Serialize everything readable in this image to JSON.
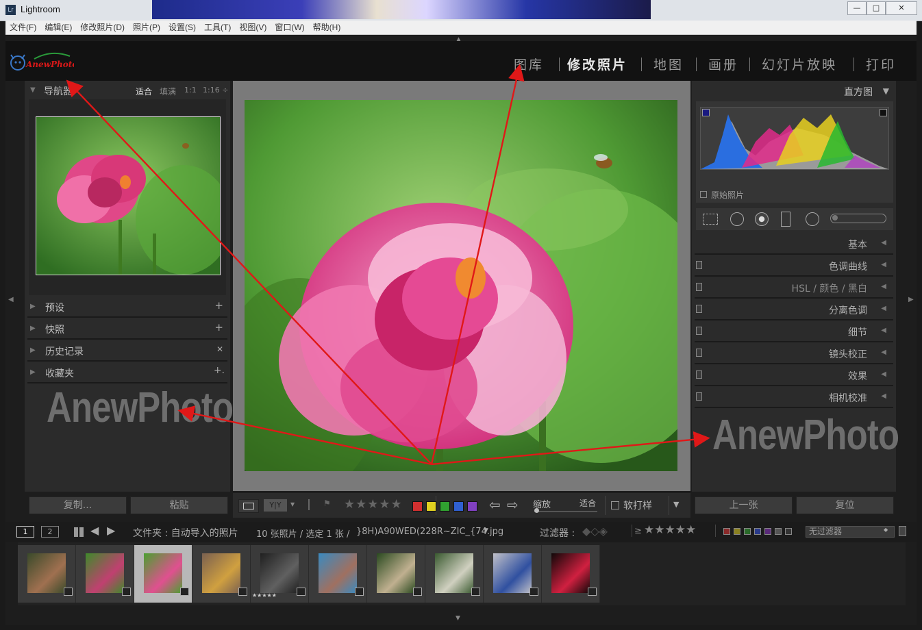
{
  "window": {
    "title": "Lightroom",
    "icon": "Lr",
    "controls": [
      "—",
      "□",
      "✕"
    ]
  },
  "menu": [
    "文件(F)",
    "编辑(E)",
    "修改照片(D)",
    "照片(P)",
    "设置(S)",
    "工具(T)",
    "视图(V)",
    "窗口(W)",
    "帮助(H)"
  ],
  "logo": {
    "text": "AnewPhoto"
  },
  "modules": [
    "图库",
    "修改照片",
    "地图",
    "画册",
    "幻灯片放映",
    "打印"
  ],
  "active_module": "修改照片",
  "navigator": {
    "title": "导航器",
    "zoom_options": [
      "适合",
      "填满",
      "1:1",
      "1:16 ÷"
    ]
  },
  "left_panels": [
    {
      "label": "预设",
      "action": "+"
    },
    {
      "label": "快照",
      "action": "+"
    },
    {
      "label": "历史记录",
      "action": "✕"
    },
    {
      "label": "收藏夹",
      "action": "+."
    }
  ],
  "watermark": "AnewPhoto",
  "left_buttons": {
    "copy": "复制...",
    "paste": "粘贴"
  },
  "histogram": {
    "title": "直方图",
    "original_label": "原始照片"
  },
  "right_panels": [
    {
      "label": "基本",
      "switch": false
    },
    {
      "label": "色调曲线",
      "switch": true
    },
    {
      "label": "HSL / 颜色 / 黑白",
      "switch": true
    },
    {
      "label": "分离色调",
      "switch": true
    },
    {
      "label": "细节",
      "switch": true
    },
    {
      "label": "镜头校正",
      "switch": true
    },
    {
      "label": "效果",
      "switch": true
    },
    {
      "label": "相机校准",
      "switch": true
    }
  ],
  "right_buttons": {
    "prev": "上一张",
    "reset": "复位"
  },
  "toolbar": {
    "stars": "★★★★★",
    "color_labels": [
      "#d03030",
      "#e0d020",
      "#30a030",
      "#3060d0",
      "#8040c0"
    ],
    "zoom_label": "缩放",
    "zoom_value": "适合",
    "soft_proof": "软打样"
  },
  "filmstrip_bar": {
    "screen1": "1",
    "screen2": "2",
    "source": "文件夹 : 自动导入的照片",
    "count": "10 张照片 / 选定 1 张 / ",
    "filename": "}8H)A90WED(228R~ZIC_{74.jpg",
    "filter_label": "过滤器 :",
    "ge": "≥",
    "filter_stars": "★★★★★",
    "filter_select": "无过滤器"
  },
  "thumbnails": [
    {
      "name": "portrait-man",
      "colors": [
        "#3a4a2a",
        "#a07050"
      ],
      "stars": ""
    },
    {
      "name": "lotus-1",
      "colors": [
        "#3e8a2a",
        "#c04070"
      ],
      "stars": ""
    },
    {
      "name": "lotus-2",
      "colors": [
        "#4aa030",
        "#e05090"
      ],
      "stars": "",
      "selected": true
    },
    {
      "name": "crowd-festival",
      "colors": [
        "#7a6050",
        "#d0a040"
      ],
      "stars": ""
    },
    {
      "name": "camera-lens",
      "colors": [
        "#202020",
        "#606060"
      ],
      "stars": "★★★★★"
    },
    {
      "name": "hat-woman",
      "colors": [
        "#3a8ac0",
        "#a07060"
      ],
      "stars": ""
    },
    {
      "name": "forest-woman",
      "colors": [
        "#2a4a20",
        "#c0b090"
      ],
      "stars": ""
    },
    {
      "name": "park-path",
      "colors": [
        "#3a5a30",
        "#d0d0c0"
      ],
      "stars": ""
    },
    {
      "name": "phone-man",
      "colors": [
        "#c0c0c8",
        "#3050a0"
      ],
      "stars": ""
    },
    {
      "name": "red-flower",
      "colors": [
        "#100808",
        "#d02040"
      ],
      "stars": ""
    }
  ],
  "colors": {
    "accent_arrow": "#e01818"
  }
}
